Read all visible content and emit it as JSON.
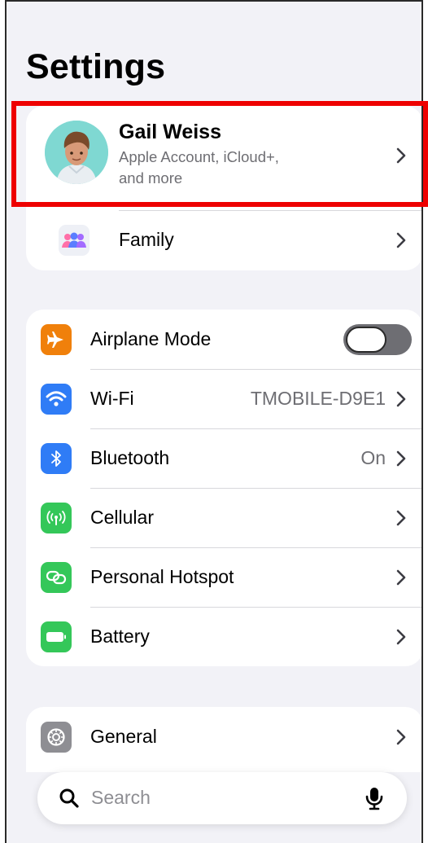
{
  "header": {
    "title": "Settings"
  },
  "account": {
    "name": "Gail Weiss",
    "subtitle_line1": "Apple Account, iCloud+,",
    "subtitle_line2": "and more",
    "family_label": "Family"
  },
  "connectivity": {
    "items": [
      {
        "label": "Airplane Mode",
        "icon": "airplane-icon",
        "color": "#f0800b",
        "toggle_on": false
      },
      {
        "label": "Wi-Fi",
        "value": "TMOBILE-D9E1",
        "icon": "wifi-icon",
        "color": "#2f7cf6"
      },
      {
        "label": "Bluetooth",
        "value": "On",
        "icon": "bluetooth-icon",
        "color": "#2f7cf6"
      },
      {
        "label": "Cellular",
        "icon": "cellular-icon",
        "color": "#34c759"
      },
      {
        "label": "Personal Hotspot",
        "icon": "hotspot-icon",
        "color": "#34c759"
      },
      {
        "label": "Battery",
        "icon": "battery-icon",
        "color": "#34c759"
      }
    ]
  },
  "general": {
    "label": "General",
    "icon": "gear-icon",
    "color": "#8e8e93"
  },
  "search": {
    "placeholder": "Search"
  },
  "highlight": {
    "color": "#ee0000",
    "target": "account-profile-row"
  }
}
